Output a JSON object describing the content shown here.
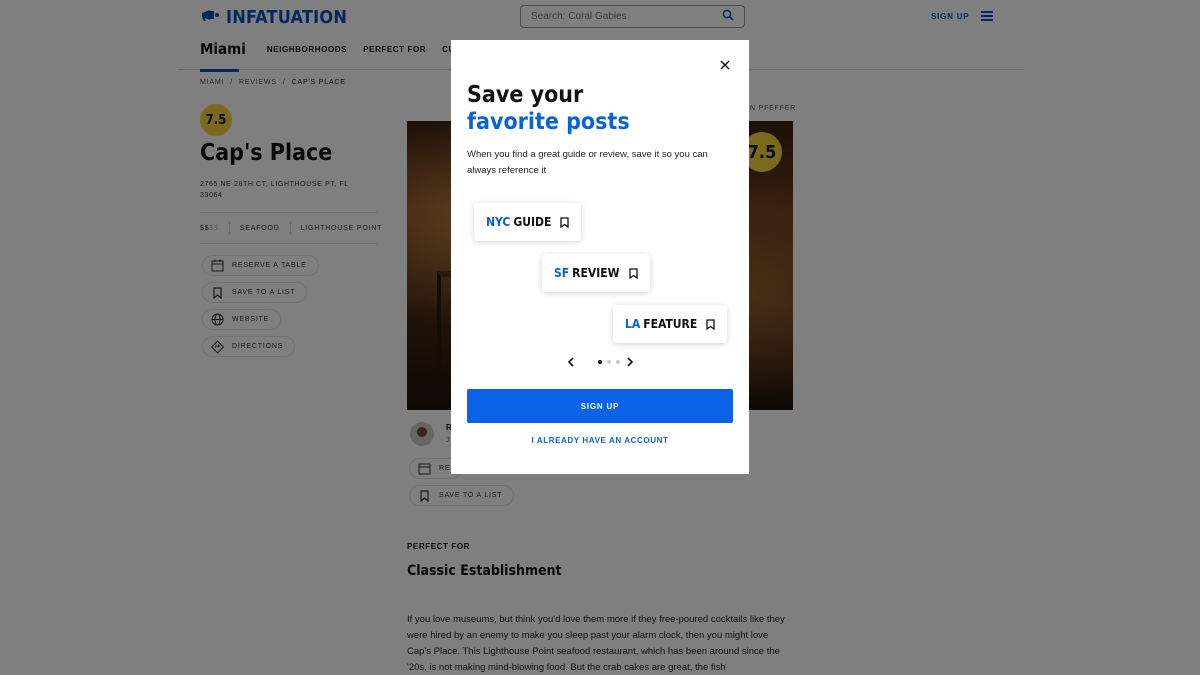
{
  "header": {
    "logo_text": "INFATUATION",
    "search": {
      "placeholder": "Search: Coral Gables"
    },
    "signup_label": "SIGN UP"
  },
  "nav": {
    "city": "Miami",
    "links": [
      "NEIGHBORHOODS",
      "PERFECT FOR",
      "CUISINES"
    ]
  },
  "breadcrumb": [
    "MIAMI",
    "REVIEWS",
    "CAP'S PLACE"
  ],
  "venue": {
    "score": "7.5",
    "name": "Cap's Place",
    "address": "2765 NE 28TH CT, LIGHTHOUSE PT, FL 33064",
    "price_active": "$$",
    "price_inactive": "$$",
    "cuisine": "SEAFOOD",
    "neighborhood": "LIGHTHOUSE POINT",
    "actions": {
      "reserve": "RESERVE A TABLE",
      "save": "SAVE TO A LIST",
      "website": "WEBSITE",
      "directions": "DIRECTIONS"
    }
  },
  "main": {
    "photo_credit": "N PFEFFER",
    "hero_score": "7.5",
    "author_initial": "R",
    "author_sub": "J",
    "reserve_partial": "RE",
    "save_label": "SAVE TO A LIST",
    "perfect_for_label": "PERFECT FOR",
    "perfect_for_value": "Classic Establishment",
    "body": "If you love museums, but think you'd love them more if they free-poured cocktails like they were hired by an enemy to make you sleep past your alarm clock, then you might love Cap's Place. This Lighthouse Point seafood restaurant, which has been around since the '20s, is not making mind-blowing food. But the crab cakes are great, the fish"
  },
  "modal": {
    "title_line1": "Save your",
    "title_line2": "favorite posts",
    "description": "When you find a great guide or review, save it so you can always reference it",
    "cards": [
      {
        "city": "NYC",
        "kind": "GUIDE"
      },
      {
        "city": "SF",
        "kind": "REVIEW"
      },
      {
        "city": "LA",
        "kind": "FEATURE"
      }
    ],
    "carousel": {
      "total": 3,
      "active": 1
    },
    "signup_label": "SIGN UP",
    "have_account_label": "I ALREADY HAVE AN ACCOUNT"
  },
  "colors": {
    "brand_blue": "#0b4fbf",
    "accent_blue": "#0b62d6",
    "button_blue": "#0b62e6",
    "score_yellow": "#f6d537"
  }
}
